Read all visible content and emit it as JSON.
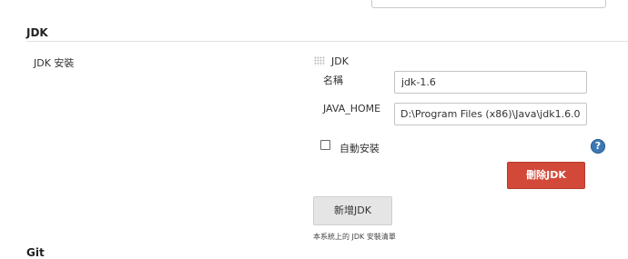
{
  "section": {
    "title": "JDK",
    "next_section_fragment": "Git"
  },
  "jdk_installations": {
    "label": "JDK 安裝",
    "block_title": "JDK",
    "name_label": "名稱",
    "name_value": "jdk-1.6",
    "java_home_label": "JAVA_HOME",
    "java_home_value": "D:\\Program Files (x86)\\Java\\jdk1.6.0",
    "auto_install_label": "自動安裝",
    "auto_install_checked": false,
    "help_icon_text": "?",
    "delete_button_label": "刪除JDK",
    "add_button_label": "新增JDK",
    "footer_note": "本系統上的 JDK 安裝清單"
  },
  "colors": {
    "delete_button": "#d24939",
    "add_button": "#e5e5e5",
    "help_icon": "#3c78b3"
  }
}
